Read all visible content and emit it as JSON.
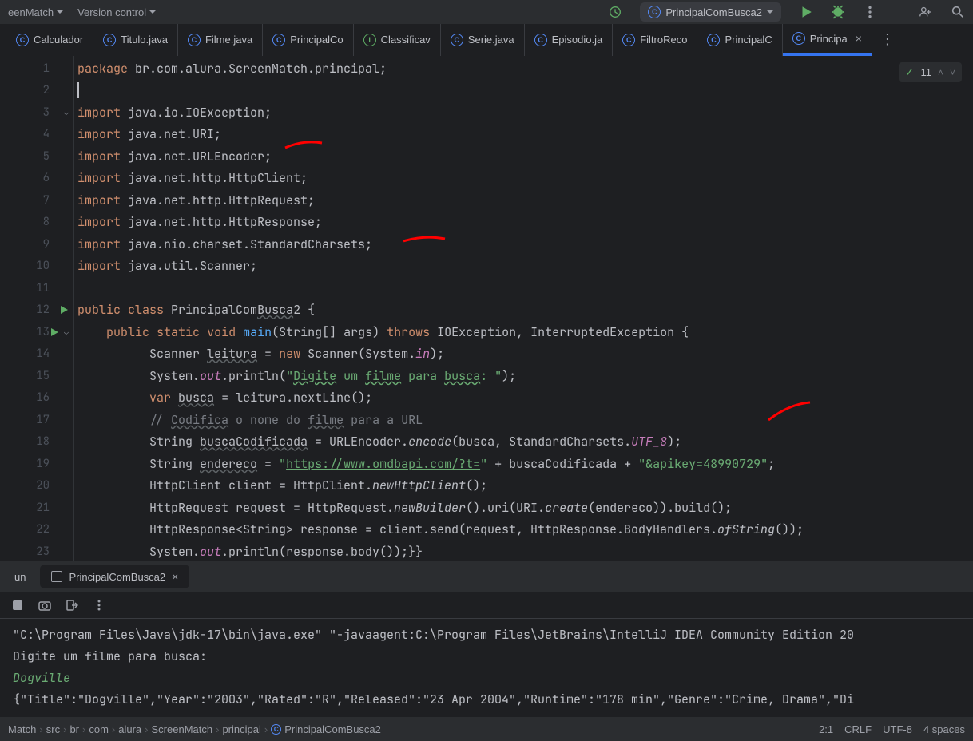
{
  "topbar": {
    "project": "eenMatch",
    "menu": "Version control",
    "current_file": "PrincipalComBusca2"
  },
  "tabs": [
    {
      "label": "Calculador",
      "icon": "C"
    },
    {
      "label": "Titulo.java",
      "icon": "C"
    },
    {
      "label": "Filme.java",
      "icon": "C"
    },
    {
      "label": "PrincipalCo",
      "icon": "C"
    },
    {
      "label": "Classificav",
      "icon": "I",
      "green": true
    },
    {
      "label": "Serie.java",
      "icon": "C"
    },
    {
      "label": "Episodio.ja",
      "icon": "C"
    },
    {
      "label": "FiltroReco",
      "icon": "C"
    },
    {
      "label": "PrincipalC",
      "icon": "C"
    },
    {
      "label": "Principa",
      "icon": "C",
      "active": true,
      "closable": true
    }
  ],
  "inspection": {
    "count": "11"
  },
  "lines": [
    "1",
    "2",
    "3",
    "4",
    "5",
    "6",
    "7",
    "8",
    "9",
    "10",
    "11",
    "12",
    "13",
    "14",
    "15",
    "16",
    "17",
    "18",
    "19",
    "20",
    "21",
    "22",
    "23"
  ],
  "code": {
    "l1": {
      "kw": "package",
      "rest": " br.com.alura.ScreenMatch.principal;"
    },
    "l3": {
      "kw": "import",
      "rest": " java.io.IOException;"
    },
    "l4": {
      "kw": "import",
      "rest": " java.net.URI;"
    },
    "l5": {
      "kw": "import",
      "rest": " java.net.URLEncoder;"
    },
    "l6": {
      "kw": "import",
      "rest": " java.net.http.HttpClient;"
    },
    "l7": {
      "kw": "import",
      "rest": " java.net.http.HttpRequest;"
    },
    "l8": {
      "kw": "import",
      "rest": " java.net.http.HttpResponse;"
    },
    "l9": {
      "kw": "import",
      "rest": " java.nio.charset.StandardCharsets;"
    },
    "l10": {
      "kw": "import",
      "rest": " java.util.Scanner;"
    },
    "l12_a": "public",
    "l12_b": "class",
    "l12_c": " PrincipalCom",
    "l12_d": "Busca",
    "l12_e": "2 {",
    "l13_a": "public",
    "l13_b": "static",
    "l13_c": "void",
    "l13_d": "main",
    "l13_e": "(String[] args) ",
    "l13_f": "throws",
    "l13_g": " IOException, InterruptedException {",
    "l14_a": "Scanner ",
    "l14_b": "leitura",
    "l14_c": " = ",
    "l14_d": "new",
    "l14_e": " Scanner(System.",
    "l14_f": "in",
    "l14_g": ");",
    "l15_a": "System.",
    "l15_b": "out",
    "l15_c": ".println(",
    "l15_d": "\"",
    "l15_e": "Digite",
    "l15_f": " um ",
    "l15_g": "filme",
    "l15_h": " para ",
    "l15_i": "busca",
    "l15_j": ": \"",
    "l15_k": ");",
    "l16_a": "var",
    "l16_b": "busca",
    "l16_c": " = leitura.nextLine();",
    "l17_a": "// ",
    "l17_b": "Codifica",
    "l17_c": " o nome do ",
    "l17_d": "filme",
    "l17_e": " para a URL",
    "l18_a": "String ",
    "l18_b": "buscaCodificada",
    "l18_c": " = URLEncoder.",
    "l18_d": "encode",
    "l18_e": "(busca, StandardCharsets.",
    "l18_f": "UTF_8",
    "l18_g": ");",
    "l19_a": "String ",
    "l19_b": "endereco",
    "l19_c": " = ",
    "l19_d": "\"",
    "l19_e": "https://www.omdbapi.com/?t=",
    "l19_f": "\"",
    "l19_g": " + buscaCodificada + ",
    "l19_h": "\"&apikey=48990729\"",
    "l19_i": ";",
    "l20_a": "HttpClient client = HttpClient.",
    "l20_b": "newHttpClient",
    "l20_c": "();",
    "l21_a": "HttpRequest request = HttpRequest.",
    "l21_b": "newBuilder",
    "l21_c": "().uri(URI.",
    "l21_d": "create",
    "l21_e": "(endereco)).build();",
    "l22_a": "HttpResponse<String> response = client.send(request, HttpResponse.BodyHandlers.",
    "l22_b": "ofString",
    "l22_c": "());",
    "l23_a": "System.",
    "l23_b": "out",
    "l23_c": ".println(response.body());}}"
  },
  "run": {
    "tab_prefix": "un",
    "tab": "PrincipalComBusca2",
    "out1": "\"C:\\Program Files\\Java\\jdk-17\\bin\\java.exe\" \"-javaagent:C:\\Program Files\\JetBrains\\IntelliJ IDEA Community Edition 20",
    "out2": "Digite um filme para busca: ",
    "out3": "Dogville",
    "out4": "{\"Title\":\"Dogville\",\"Year\":\"2003\",\"Rated\":\"R\",\"Released\":\"23 Apr 2004\",\"Runtime\":\"178 min\",\"Genre\":\"Crime, Drama\",\"Di"
  },
  "breadcrumb": [
    "Match",
    "src",
    "br",
    "com",
    "alura",
    "ScreenMatch",
    "principal",
    "PrincipalComBusca2"
  ],
  "status": {
    "pos": "2:1",
    "enc": "CRLF",
    "charset": "UTF-8",
    "indent": "4 spaces"
  }
}
